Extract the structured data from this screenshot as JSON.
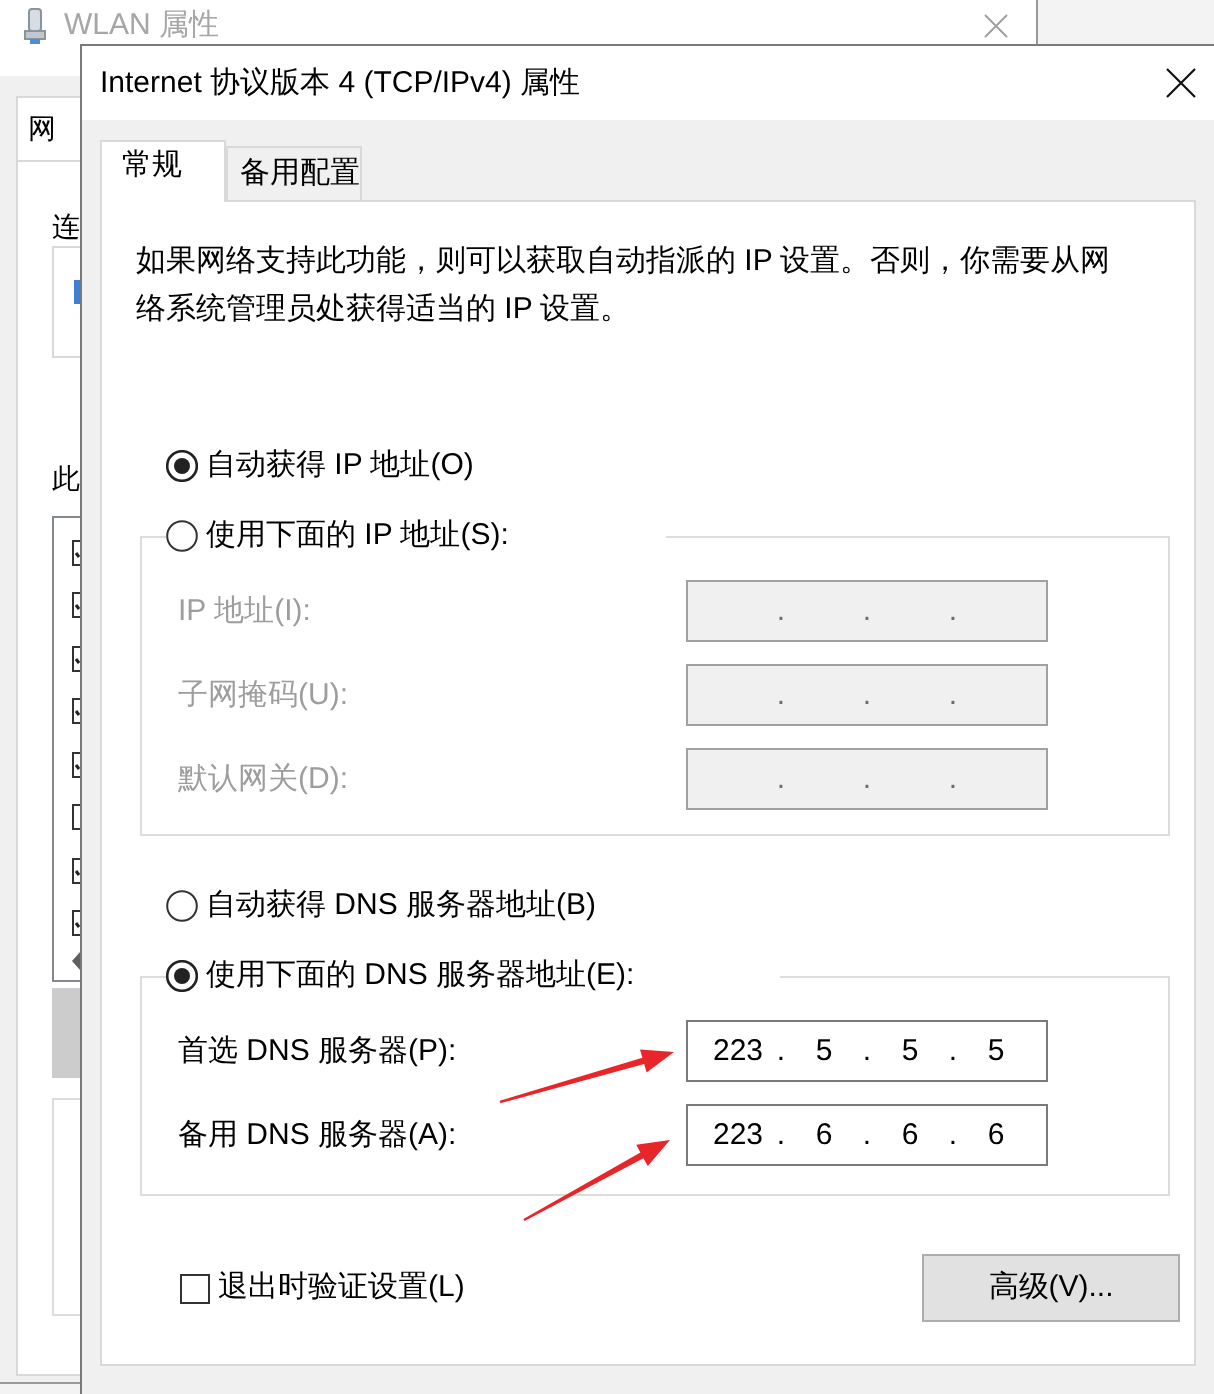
{
  "background_window": {
    "title": "WLAN 属性",
    "tab": "网",
    "labels": [
      "连",
      "此"
    ],
    "list_items": [
      {
        "checked": true
      },
      {
        "checked": true
      },
      {
        "checked": true
      },
      {
        "checked": true
      },
      {
        "checked": true
      },
      {
        "checked": false
      },
      {
        "checked": true
      },
      {
        "checked": true
      }
    ]
  },
  "window": {
    "title": "Internet 协议版本 4 (TCP/IPv4) 属性"
  },
  "tabs": [
    {
      "label": "常规",
      "selected": true
    },
    {
      "label": "备用配置",
      "selected": false
    }
  ],
  "description": "如果网络支持此功能，则可以获取自动指派的 IP 设置。否则，你需要从网络系统管理员处获得适当的 IP 设置。",
  "ip_options": [
    {
      "label": "自动获得 IP 地址(O)",
      "selected": true
    },
    {
      "label": "使用下面的 IP 地址(S):",
      "selected": false
    }
  ],
  "ip_fields": [
    {
      "label": "IP 地址(I):",
      "disabled": true,
      "dots": [
        ".",
        ".",
        "."
      ]
    },
    {
      "label": "子网掩码(U):",
      "disabled": true,
      "dots": [
        ".",
        ".",
        "."
      ]
    },
    {
      "label": "默认网关(D):",
      "disabled": true,
      "dots": [
        ".",
        ".",
        "."
      ]
    }
  ],
  "dns_options": [
    {
      "label": "自动获得 DNS 服务器地址(B)",
      "selected": false
    },
    {
      "label": "使用下面的 DNS 服务器地址(E):",
      "selected": true
    }
  ],
  "dns_fields": [
    {
      "label": "首选 DNS 服务器(P):",
      "disabled": false,
      "octets": [
        "223",
        "5",
        "5",
        "5"
      ],
      "dots": [
        ".",
        ".",
        "."
      ],
      "arrow": true
    },
    {
      "label": "备用 DNS 服务器(A):",
      "disabled": false,
      "octets": [
        "223",
        "6",
        "6",
        "6"
      ],
      "dots": [
        ".",
        ".",
        "."
      ],
      "arrow": true
    }
  ],
  "validate_on_exit": {
    "label": "退出时验证设置(L)",
    "checked": false
  },
  "buttons": [
    {
      "label": "高级(V)..."
    }
  ]
}
